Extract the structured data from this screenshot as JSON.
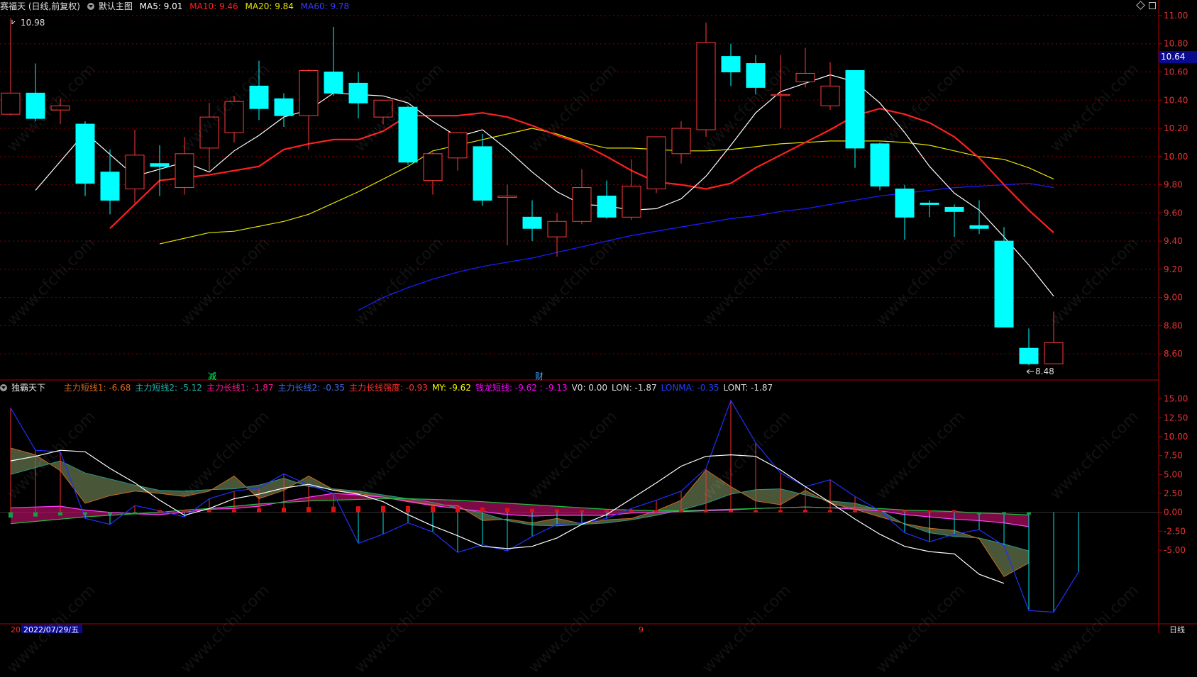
{
  "top_header": {
    "stock_title": "赛福天 (日线,前复权)",
    "main_chart_label": "默认主图",
    "ma5": "MA5: 9.01",
    "ma10": "MA10: 9.46",
    "ma20": "MA20: 9.84",
    "ma60": "MA60: 9.78"
  },
  "bottom_header": {
    "indicator_name": "独霸天下",
    "items": [
      {
        "text": "主力短线1: -6.68",
        "color": "#d2691e"
      },
      {
        "text": "主力短线2: -5.12",
        "color": "#20b2aa"
      },
      {
        "text": "主力长线1: -1.87",
        "color": "#ff1493"
      },
      {
        "text": "主力长线2: -0.35",
        "color": "#4169e1"
      },
      {
        "text": "主力长线强度: -0.93",
        "color": "#ff3030"
      },
      {
        "text": "MY: -9.62",
        "color": "#ffff00"
      },
      {
        "text": "钱龙短线: -9.62 : -9.13",
        "color": "#ff00ff"
      },
      {
        "text": "V0: 0.00",
        "color": "#dddddd"
      },
      {
        "text": "LON: -1.87",
        "color": "#dddddd"
      },
      {
        "text": "LONMA: -0.35",
        "color": "#2040ff"
      },
      {
        "text": "LONT: -1.87",
        "color": "#dddddd"
      }
    ]
  },
  "price_tag": "10.64",
  "annotations": {
    "high_label": "10.98",
    "low_label": "8.48",
    "marker_jian": "减",
    "marker_cai": "财",
    "bottom_date": "2022/07/29/五",
    "bottom_left": "20",
    "bottom_mid": "9",
    "period_label": "日线"
  },
  "watermark": "www.cfchi.com",
  "colors": {
    "up": "#ff3b3b",
    "down": "#00ffff",
    "ma5": "#ffffff",
    "ma10": "#ff2020",
    "ma20": "#e6e600",
    "ma60": "#1a1aff",
    "grid": "#8b0000",
    "axis": "#b00000"
  },
  "chart_data": [
    {
      "type": "candlestick",
      "title": "赛福天 (日线,前复权)",
      "y_ticks": [
        11.0,
        10.8,
        10.6,
        10.4,
        10.2,
        10.0,
        9.8,
        9.6,
        9.4,
        9.2,
        9.0,
        8.8,
        8.6
      ],
      "ylim": [
        8.42,
        11.05
      ],
      "candles": [
        {
          "o": 10.3,
          "h": 10.98,
          "l": 10.29,
          "c": 10.45
        },
        {
          "o": 10.45,
          "h": 10.66,
          "l": 10.25,
          "c": 10.27
        },
        {
          "o": 10.33,
          "h": 10.41,
          "l": 10.23,
          "c": 10.36
        },
        {
          "o": 10.23,
          "h": 10.25,
          "l": 9.72,
          "c": 9.81
        },
        {
          "o": 9.89,
          "h": 10.05,
          "l": 9.59,
          "c": 9.69
        },
        {
          "o": 9.77,
          "h": 10.19,
          "l": 9.67,
          "c": 10.01
        },
        {
          "o": 9.95,
          "h": 10.08,
          "l": 9.72,
          "c": 9.93
        },
        {
          "o": 9.78,
          "h": 10.14,
          "l": 9.73,
          "c": 10.02
        },
        {
          "o": 10.06,
          "h": 10.38,
          "l": 9.9,
          "c": 10.28
        },
        {
          "o": 10.17,
          "h": 10.43,
          "l": 10.1,
          "c": 10.39
        },
        {
          "o": 10.5,
          "h": 10.68,
          "l": 10.26,
          "c": 10.34
        },
        {
          "o": 10.41,
          "h": 10.45,
          "l": 10.21,
          "c": 10.29
        },
        {
          "o": 10.29,
          "h": 10.62,
          "l": 10.05,
          "c": 10.61
        },
        {
          "o": 10.6,
          "h": 10.92,
          "l": 10.43,
          "c": 10.45
        },
        {
          "o": 10.52,
          "h": 10.6,
          "l": 10.27,
          "c": 10.38
        },
        {
          "o": 10.28,
          "h": 10.4,
          "l": 10.23,
          "c": 10.4
        },
        {
          "o": 10.35,
          "h": 10.36,
          "l": 9.94,
          "c": 9.96
        },
        {
          "o": 9.83,
          "h": 10.03,
          "l": 9.73,
          "c": 10.02
        },
        {
          "o": 9.99,
          "h": 10.14,
          "l": 9.9,
          "c": 10.17
        },
        {
          "o": 10.07,
          "h": 10.16,
          "l": 9.65,
          "c": 9.69
        },
        {
          "o": 9.71,
          "h": 9.8,
          "l": 9.37,
          "c": 9.72
        },
        {
          "o": 9.57,
          "h": 9.69,
          "l": 9.4,
          "c": 9.49
        },
        {
          "o": 9.43,
          "h": 9.6,
          "l": 9.29,
          "c": 9.54
        },
        {
          "o": 9.54,
          "h": 9.91,
          "l": 9.52,
          "c": 9.78
        },
        {
          "o": 9.72,
          "h": 9.83,
          "l": 9.56,
          "c": 9.57
        },
        {
          "o": 9.57,
          "h": 9.98,
          "l": 9.55,
          "c": 9.79
        },
        {
          "o": 9.77,
          "h": 10.13,
          "l": 9.74,
          "c": 10.14
        },
        {
          "o": 10.02,
          "h": 10.25,
          "l": 9.95,
          "c": 10.2
        },
        {
          "o": 10.19,
          "h": 10.95,
          "l": 10.14,
          "c": 10.81
        },
        {
          "o": 10.71,
          "h": 10.8,
          "l": 10.5,
          "c": 10.6
        },
        {
          "o": 10.66,
          "h": 10.72,
          "l": 10.44,
          "c": 10.49
        },
        {
          "o": 10.44,
          "h": 10.72,
          "l": 10.2,
          "c": 10.44
        },
        {
          "o": 10.53,
          "h": 10.77,
          "l": 10.49,
          "c": 10.59
        },
        {
          "o": 10.36,
          "h": 10.67,
          "l": 10.33,
          "c": 10.5
        },
        {
          "o": 10.61,
          "h": 10.61,
          "l": 9.92,
          "c": 10.06
        },
        {
          "o": 10.09,
          "h": 10.1,
          "l": 9.76,
          "c": 9.79
        },
        {
          "o": 9.77,
          "h": 9.8,
          "l": 9.41,
          "c": 9.57
        },
        {
          "o": 9.67,
          "h": 9.69,
          "l": 9.57,
          "c": 9.66
        },
        {
          "o": 9.64,
          "h": 9.66,
          "l": 9.43,
          "c": 9.61
        },
        {
          "o": 9.51,
          "h": 9.69,
          "l": 9.45,
          "c": 9.49
        },
        {
          "o": 9.4,
          "h": 9.5,
          "l": 8.79,
          "c": 8.79
        },
        {
          "o": 8.64,
          "h": 8.78,
          "l": 8.52,
          "c": 8.53
        },
        {
          "o": 8.53,
          "h": 8.9,
          "l": 8.53,
          "c": 8.68
        }
      ],
      "ma5": [
        9.76,
        null,
        10.17,
        null,
        9.86,
        null,
        9.96,
        9.89,
        10.04,
        10.15,
        10.28,
        10.33,
        10.45,
        10.44,
        10.43,
        10.38,
        10.25,
        10.14,
        10.19,
        10.05,
        9.89,
        9.75,
        9.66,
        9.65,
        9.62,
        9.63,
        9.7,
        9.86,
        10.08,
        10.31,
        10.46,
        10.52,
        10.58,
        10.53,
        10.38,
        10.17,
        9.93,
        9.74,
        9.62,
        9.43,
        9.23,
        9.01
      ],
      "ma10": [
        9.49,
        null,
        9.83,
        null,
        9.87,
        9.9,
        9.93,
        10.05,
        10.09,
        10.12,
        10.12,
        10.18,
        10.29,
        10.29,
        10.29,
        10.31,
        10.28,
        10.22,
        10.15,
        10.09,
        10.0,
        9.9,
        9.82,
        9.8,
        9.77,
        9.81,
        9.92,
        10.01,
        10.1,
        10.19,
        10.29,
        10.34,
        10.3,
        10.24,
        10.14,
        9.99,
        9.8,
        9.62,
        9.46
      ],
      "ma20": [
        9.38,
        null,
        9.46,
        9.47,
        null,
        9.54,
        9.59,
        9.67,
        9.75,
        9.84,
        9.93,
        10.04,
        10.08,
        10.12,
        10.16,
        10.2,
        10.16,
        10.1,
        10.06,
        10.06,
        10.05,
        10.04,
        10.04,
        10.05,
        10.07,
        10.09,
        10.1,
        10.11,
        10.11,
        10.11,
        10.1,
        10.08,
        10.04,
        10.0,
        9.98,
        9.92,
        9.84
      ],
      "ma60": [
        8.91,
        9.0,
        9.07,
        9.13,
        9.18,
        9.22,
        9.25,
        9.28,
        9.32,
        9.36,
        9.4,
        9.44,
        9.47,
        9.5,
        9.53,
        9.56,
        9.58,
        9.61,
        9.63,
        9.66,
        9.69,
        9.72,
        9.74,
        9.76,
        9.78,
        9.79,
        9.8,
        9.81,
        9.78
      ]
    },
    {
      "type": "area",
      "title": "独霸天下",
      "y_ticks": [
        15.0,
        12.5,
        10.0,
        7.5,
        5.0,
        2.5,
        0.0,
        -2.5,
        -5.0
      ],
      "ylim": [
        -14,
        16
      ],
      "series": [
        {
          "name": "主力短线1",
          "values": [
            8.5,
            7.6,
            5.5,
            1.2,
            2.2,
            2.8,
            2.5,
            2.1,
            2.8,
            4.8,
            1.8,
            2.9,
            4.8,
            3.0,
            2.5,
            2.0,
            1.5,
            1.0,
            0.9,
            -1.1,
            -0.9,
            -1.4,
            -0.8,
            -1.5,
            -1.0,
            -0.8,
            0.2,
            1.6,
            5.6,
            3.4,
            1.5,
            1.0,
            2.9,
            1.2,
            0.4,
            -0.6,
            -1.5,
            -2.1,
            -2.4,
            -3.5,
            -8.5,
            -6.7
          ]
        },
        {
          "name": "主力短线2",
          "values": [
            5.0,
            5.9,
            6.8,
            5.2,
            4.4,
            3.6,
            2.9,
            2.8,
            3.0,
            3.1,
            3.6,
            4.5,
            3.4,
            3.1,
            2.8,
            2.3,
            1.8,
            1.3,
            0.6,
            -0.1,
            -1.1,
            -1.7,
            -1.8,
            -1.6,
            -1.4,
            -1.0,
            -0.4,
            0.3,
            1.2,
            2.4,
            3.0,
            3.1,
            2.3,
            1.5,
            1.2,
            0.3,
            -1.6,
            -2.7,
            -3.2,
            -3.4,
            -4.2,
            -5.1
          ]
        },
        {
          "name": "主力长线1",
          "values": [
            0.6,
            0.7,
            0.8,
            0.3,
            0.0,
            -0.2,
            -0.3,
            0.0,
            0.4,
            0.5,
            0.8,
            1.4,
            2.0,
            2.5,
            2.3,
            2.0,
            1.4,
            0.9,
            0.5,
            0.1,
            -0.3,
            -0.5,
            -0.4,
            -0.4,
            -0.4,
            -0.1,
            0.0,
            0.1,
            0.2,
            0.3,
            0.5,
            0.6,
            0.7,
            0.6,
            0.4,
            0.2,
            -0.3,
            -0.6,
            -0.9,
            -1.1,
            -1.4,
            -1.9
          ]
        },
        {
          "name": "主力长线2",
          "values": [
            -1.5,
            -1.2,
            -0.9,
            -0.6,
            -0.4,
            -0.2,
            0.0,
            0.3,
            0.5,
            0.8,
            1.1,
            1.3,
            1.5,
            1.6,
            1.7,
            1.8,
            1.8,
            1.7,
            1.6,
            1.4,
            1.2,
            1.0,
            0.8,
            0.6,
            0.4,
            0.3,
            0.2,
            0.2,
            0.3,
            0.4,
            0.5,
            0.6,
            0.7,
            0.6,
            0.6,
            0.5,
            0.3,
            0.2,
            0.1,
            -0.1,
            -0.2,
            -0.35
          ]
        },
        {
          "name": "LONT",
          "values": [
            6.8,
            7.4,
            8.2,
            8.0,
            5.8,
            3.9,
            1.6,
            -0.4,
            0.5,
            1.8,
            2.4,
            3.2,
            3.7,
            2.9,
            2.4,
            1.4,
            -0.3,
            -1.8,
            -3.1,
            -4.5,
            -4.8,
            -4.5,
            -3.4,
            -1.6,
            -0.3,
            1.8,
            3.9,
            6.1,
            7.4,
            7.6,
            7.4,
            5.6,
            3.4,
            1.3,
            -0.9,
            -2.9,
            -4.5,
            -5.2,
            -5.5,
            -8.2,
            -9.4
          ]
        },
        {
          "name": "V0",
          "values": [
            13.8,
            8.2,
            8.0,
            -0.8,
            -1.6,
            0.9,
            0.2,
            -0.6,
            1.8,
            2.8,
            3.2,
            5.1,
            3.6,
            2.5,
            -4.1,
            -2.9,
            -1.4,
            -2.6,
            -5.3,
            -4.3,
            -5.1,
            -3.2,
            -1.6,
            -1.4,
            -0.8,
            0.5,
            1.6,
            2.8,
            5.8,
            14.8,
            9.2,
            5.2,
            3.4,
            4.3,
            2.1,
            0.2,
            -2.7,
            -3.9,
            -2.9,
            -2.3,
            -4.4,
            -13.0,
            -13.2,
            -7.9
          ]
        }
      ]
    }
  ]
}
